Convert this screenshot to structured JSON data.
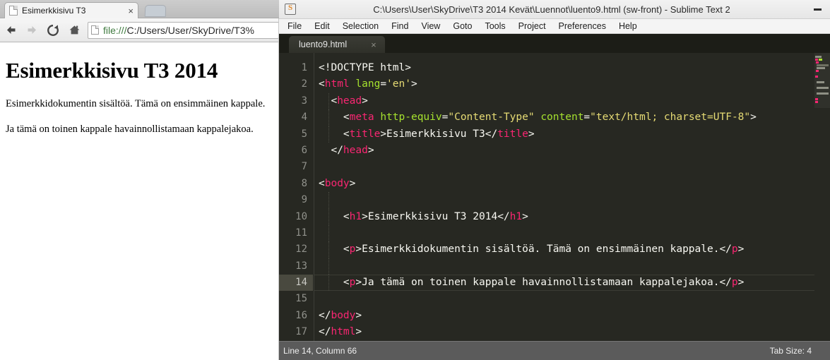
{
  "browser": {
    "tab": {
      "title": "Esimerkkisivu T3",
      "close_label": "×",
      "favicon": "page-icon"
    },
    "newtab_label": "",
    "toolbar": {
      "back": "back-arrow-icon",
      "forward": "forward-arrow-icon",
      "reload": "reload-icon",
      "home": "home-icon",
      "url_scheme": "file:///",
      "url_rest": "C:/Users/User/SkyDrive/T3%",
      "url_full": "file:///C:/Users/User/SkyDrive/T3%"
    },
    "page": {
      "heading": "Esimerkkisivu T3 2014",
      "paragraph1": "Esimerkkidokumentin sisältöä. Tämä on ensimmäinen kappale.",
      "paragraph2": "Ja tämä on toinen kappale havainnollistamaan kappalejakoa."
    }
  },
  "sublime": {
    "title": "C:\\Users\\User\\SkyDrive\\T3 2014 Kevät\\Luennot\\luento9.html (sw-front) - Sublime Text 2",
    "app_icon": "sublime-icon",
    "window_controls": {
      "minimize": "minimize-icon"
    },
    "menu": [
      "File",
      "Edit",
      "Selection",
      "Find",
      "View",
      "Goto",
      "Tools",
      "Project",
      "Preferences",
      "Help"
    ],
    "tab": {
      "name": "luento9.html",
      "close_label": "×"
    },
    "status": {
      "left": "Line 14, Column 66",
      "right": "Tab Size: 4"
    },
    "current_line": 14,
    "code": [
      {
        "n": 1,
        "indent": 0,
        "tokens": [
          {
            "t": "punc",
            "v": "<!DOCTYPE html>"
          }
        ]
      },
      {
        "n": 2,
        "indent": 0,
        "tokens": [
          {
            "t": "punc",
            "v": "<"
          },
          {
            "t": "tag",
            "v": "html"
          },
          {
            "t": "txt",
            "v": " "
          },
          {
            "t": "attr",
            "v": "lang"
          },
          {
            "t": "punc",
            "v": "="
          },
          {
            "t": "val",
            "v": "'en'"
          },
          {
            "t": "punc",
            "v": ">"
          }
        ]
      },
      {
        "n": 3,
        "indent": 1,
        "tokens": [
          {
            "t": "punc",
            "v": "  <"
          },
          {
            "t": "tag",
            "v": "head"
          },
          {
            "t": "punc",
            "v": ">"
          }
        ]
      },
      {
        "n": 4,
        "indent": 1,
        "tokens": [
          {
            "t": "punc",
            "v": "    <"
          },
          {
            "t": "tag",
            "v": "meta"
          },
          {
            "t": "txt",
            "v": " "
          },
          {
            "t": "attr",
            "v": "http-equiv"
          },
          {
            "t": "punc",
            "v": "="
          },
          {
            "t": "val",
            "v": "\"Content-Type\""
          },
          {
            "t": "txt",
            "v": " "
          },
          {
            "t": "attr",
            "v": "content"
          },
          {
            "t": "punc",
            "v": "="
          },
          {
            "t": "val",
            "v": "\"text/html; charset=UTF-8\""
          },
          {
            "t": "punc",
            "v": ">"
          }
        ]
      },
      {
        "n": 5,
        "indent": 1,
        "tokens": [
          {
            "t": "punc",
            "v": "    <"
          },
          {
            "t": "tag",
            "v": "title"
          },
          {
            "t": "punc",
            "v": ">"
          },
          {
            "t": "txt",
            "v": "Esimerkkisivu T3"
          },
          {
            "t": "punc",
            "v": "</"
          },
          {
            "t": "tag",
            "v": "title"
          },
          {
            "t": "punc",
            "v": ">"
          }
        ]
      },
      {
        "n": 6,
        "indent": 0,
        "tokens": [
          {
            "t": "punc",
            "v": "  </"
          },
          {
            "t": "tag",
            "v": "head"
          },
          {
            "t": "punc",
            "v": ">"
          }
        ]
      },
      {
        "n": 7,
        "indent": 0,
        "tokens": []
      },
      {
        "n": 8,
        "indent": 0,
        "tokens": [
          {
            "t": "punc",
            "v": "<"
          },
          {
            "t": "tag",
            "v": "body"
          },
          {
            "t": "punc",
            "v": ">"
          }
        ]
      },
      {
        "n": 9,
        "indent": 1,
        "tokens": []
      },
      {
        "n": 10,
        "indent": 1,
        "tokens": [
          {
            "t": "punc",
            "v": "    <"
          },
          {
            "t": "tag",
            "v": "h1"
          },
          {
            "t": "punc",
            "v": ">"
          },
          {
            "t": "txt",
            "v": "Esimerkkisivu T3 2014"
          },
          {
            "t": "punc",
            "v": "</"
          },
          {
            "t": "tag",
            "v": "h1"
          },
          {
            "t": "punc",
            "v": ">"
          }
        ]
      },
      {
        "n": 11,
        "indent": 1,
        "tokens": []
      },
      {
        "n": 12,
        "indent": 1,
        "tokens": [
          {
            "t": "punc",
            "v": "    <"
          },
          {
            "t": "tag",
            "v": "p"
          },
          {
            "t": "punc",
            "v": ">"
          },
          {
            "t": "txt",
            "v": "Esimerkkidokumentin sisältöä. Tämä on ensimmäinen kappale."
          },
          {
            "t": "punc",
            "v": "</"
          },
          {
            "t": "tag",
            "v": "p"
          },
          {
            "t": "punc",
            "v": ">"
          }
        ]
      },
      {
        "n": 13,
        "indent": 1,
        "tokens": []
      },
      {
        "n": 14,
        "indent": 1,
        "tokens": [
          {
            "t": "punc",
            "v": "    <"
          },
          {
            "t": "tag",
            "v": "p"
          },
          {
            "t": "punc",
            "v": ">"
          },
          {
            "t": "txt",
            "v": "Ja tämä on toinen kappale havainnollistamaan kappalejakoa."
          },
          {
            "t": "punc",
            "v": "</"
          },
          {
            "t": "tag",
            "v": "p"
          },
          {
            "t": "punc",
            "v": ">"
          }
        ]
      },
      {
        "n": 15,
        "indent": 0,
        "tokens": []
      },
      {
        "n": 16,
        "indent": 0,
        "tokens": [
          {
            "t": "punc",
            "v": "</"
          },
          {
            "t": "tag",
            "v": "body"
          },
          {
            "t": "punc",
            "v": ">"
          }
        ]
      },
      {
        "n": 17,
        "indent": 0,
        "tokens": [
          {
            "t": "punc",
            "v": "</"
          },
          {
            "t": "tag",
            "v": "html"
          },
          {
            "t": "punc",
            "v": ">"
          }
        ]
      }
    ],
    "minimap": [
      [
        {
          "x": 1,
          "w": 9,
          "c": "#8f9084"
        }
      ],
      [
        {
          "x": 1,
          "w": 4,
          "c": "#f92672"
        },
        {
          "x": 6,
          "w": 5,
          "c": "#a6e22e"
        }
      ],
      [
        {
          "x": 2,
          "w": 4,
          "c": "#f92672"
        }
      ],
      [
        {
          "x": 3,
          "w": 17,
          "c": "#6e6f62"
        }
      ],
      [
        {
          "x": 3,
          "w": 12,
          "c": "#8f9084"
        }
      ],
      [
        {
          "x": 2,
          "w": 4,
          "c": "#f92672"
        }
      ],
      [],
      [
        {
          "x": 1,
          "w": 4,
          "c": "#f92672"
        }
      ],
      [],
      [
        {
          "x": 3,
          "w": 11,
          "c": "#8f9084"
        }
      ],
      [],
      [
        {
          "x": 3,
          "w": 17,
          "c": "#8f9084"
        }
      ],
      [],
      [
        {
          "x": 3,
          "w": 17,
          "c": "#8f9084"
        }
      ],
      [],
      [
        {
          "x": 1,
          "w": 4,
          "c": "#f92672"
        }
      ],
      [
        {
          "x": 1,
          "w": 4,
          "c": "#f92672"
        }
      ]
    ],
    "colors": {
      "background": "#272822",
      "foreground": "#f8f8f2",
      "tag": "#f92672",
      "attribute": "#a6e22e",
      "value": "#e6db74",
      "line_number": "#90918b",
      "current_line_gutter": "#49493f",
      "statusbar": "#5b5b5b"
    }
  }
}
